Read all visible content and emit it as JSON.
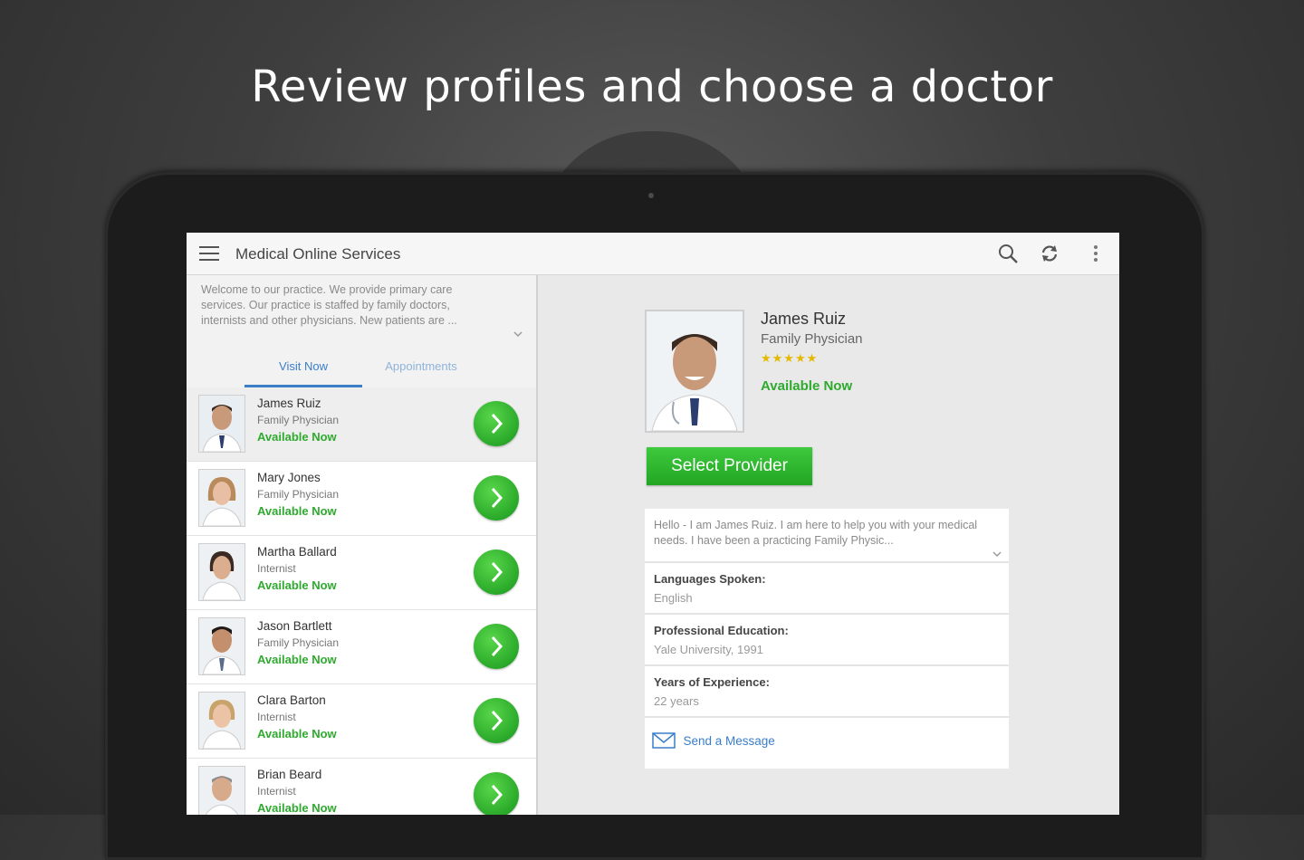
{
  "headline": "Review profiles and choose a doctor",
  "app": {
    "title": "Medical Online Services",
    "icons": [
      "hamburger-menu-icon",
      "search-icon",
      "refresh-icon",
      "overflow-menu-icon"
    ]
  },
  "welcome_text": "Welcome to our practice. We provide primary care services. Our practice is staffed by family doctors, internists and other physicians. New patients are ...",
  "tabs": [
    {
      "label": "Visit Now",
      "active": true
    },
    {
      "label": "Appointments",
      "active": false
    }
  ],
  "doctors": [
    {
      "name": "James Ruiz",
      "specialty": "Family Physician",
      "status": "Available Now"
    },
    {
      "name": "Mary Jones",
      "specialty": "Family Physician",
      "status": "Available Now"
    },
    {
      "name": "Martha Ballard",
      "specialty": "Internist",
      "status": "Available Now"
    },
    {
      "name": "Jason Bartlett",
      "specialty": "Family Physician",
      "status": "Available Now"
    },
    {
      "name": "Clara Barton",
      "specialty": "Internist",
      "status": "Available Now"
    },
    {
      "name": "Brian Beard",
      "specialty": "Internist",
      "status": "Available Now"
    }
  ],
  "detail": {
    "name": "James Ruiz",
    "specialty": "Family Physician",
    "rating": 5,
    "rating_stars": "★★★★★",
    "status": "Available Now",
    "select_button": "Select Provider",
    "bio": "Hello - I am James Ruiz. I am here to help you with your medical needs. I have been a practicing Family Physic...",
    "languages_label": "Languages Spoken:",
    "languages_value": "English",
    "education_label": "Professional Education:",
    "education_value": "Yale University, 1991",
    "experience_label": "Years of Experience:",
    "experience_value": "22 years",
    "send_message": "Send a Message"
  },
  "colors": {
    "available_green": "#2eaa2e",
    "accent_blue": "#3a7ec8",
    "star_gold": "#e5b800"
  }
}
